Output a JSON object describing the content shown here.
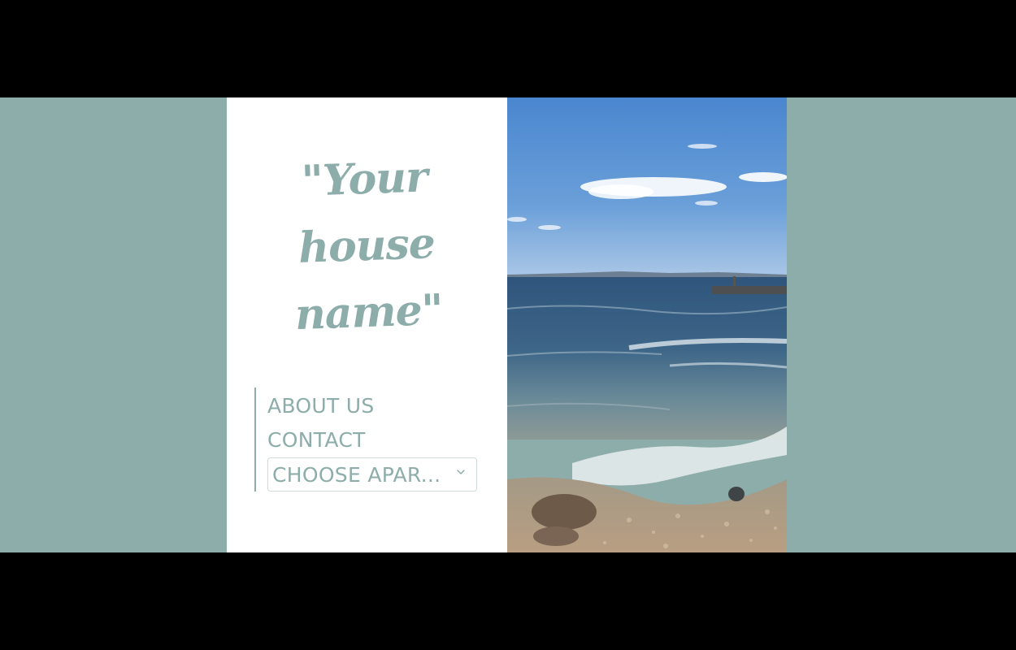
{
  "header": {
    "title": "\"Your house name\""
  },
  "nav": {
    "items": [
      {
        "label": "ABOUT US"
      },
      {
        "label": "CONTACT"
      }
    ],
    "select": {
      "selected": "CHOOSE APAR..."
    }
  },
  "icons": {
    "select_chevron": "chevron-down-icon"
  },
  "colors": {
    "accent": "#8dadaa",
    "page_background": "#8dadaa",
    "card_background": "#ffffff"
  }
}
